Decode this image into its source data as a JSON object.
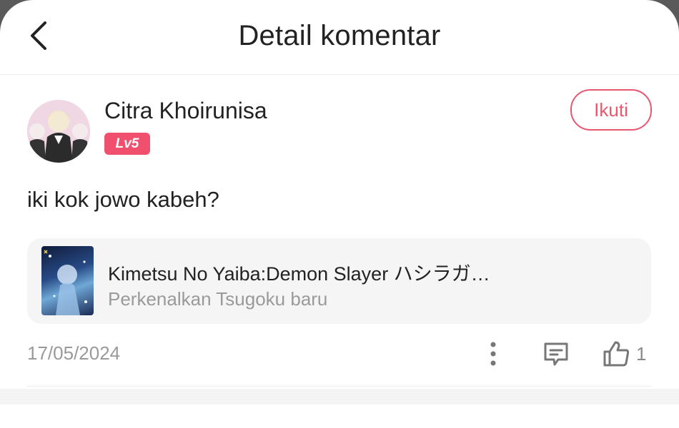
{
  "header": {
    "title": "Detail komentar",
    "back_icon": "chevron-left-icon"
  },
  "comment": {
    "username": "Citra Khoirunisa",
    "level": "Lv5",
    "follow_label": "Ikuti",
    "text": "iki kok jowo kabeh?",
    "date": "17/05/2024",
    "like_count": "1"
  },
  "reference": {
    "title": "Kimetsu No Yaiba:Demon Slayer ハシラガ…",
    "subtitle": "Perkenalkan Tsugoku baru"
  },
  "colors": {
    "accent": "#e8566f",
    "badge": "#f0506e",
    "muted_text": "#9a9a9a",
    "card_bg": "#f5f5f5"
  },
  "icons": [
    "chevron-left-icon",
    "more-vertical-icon",
    "reply-comment-icon",
    "thumbs-up-icon"
  ]
}
